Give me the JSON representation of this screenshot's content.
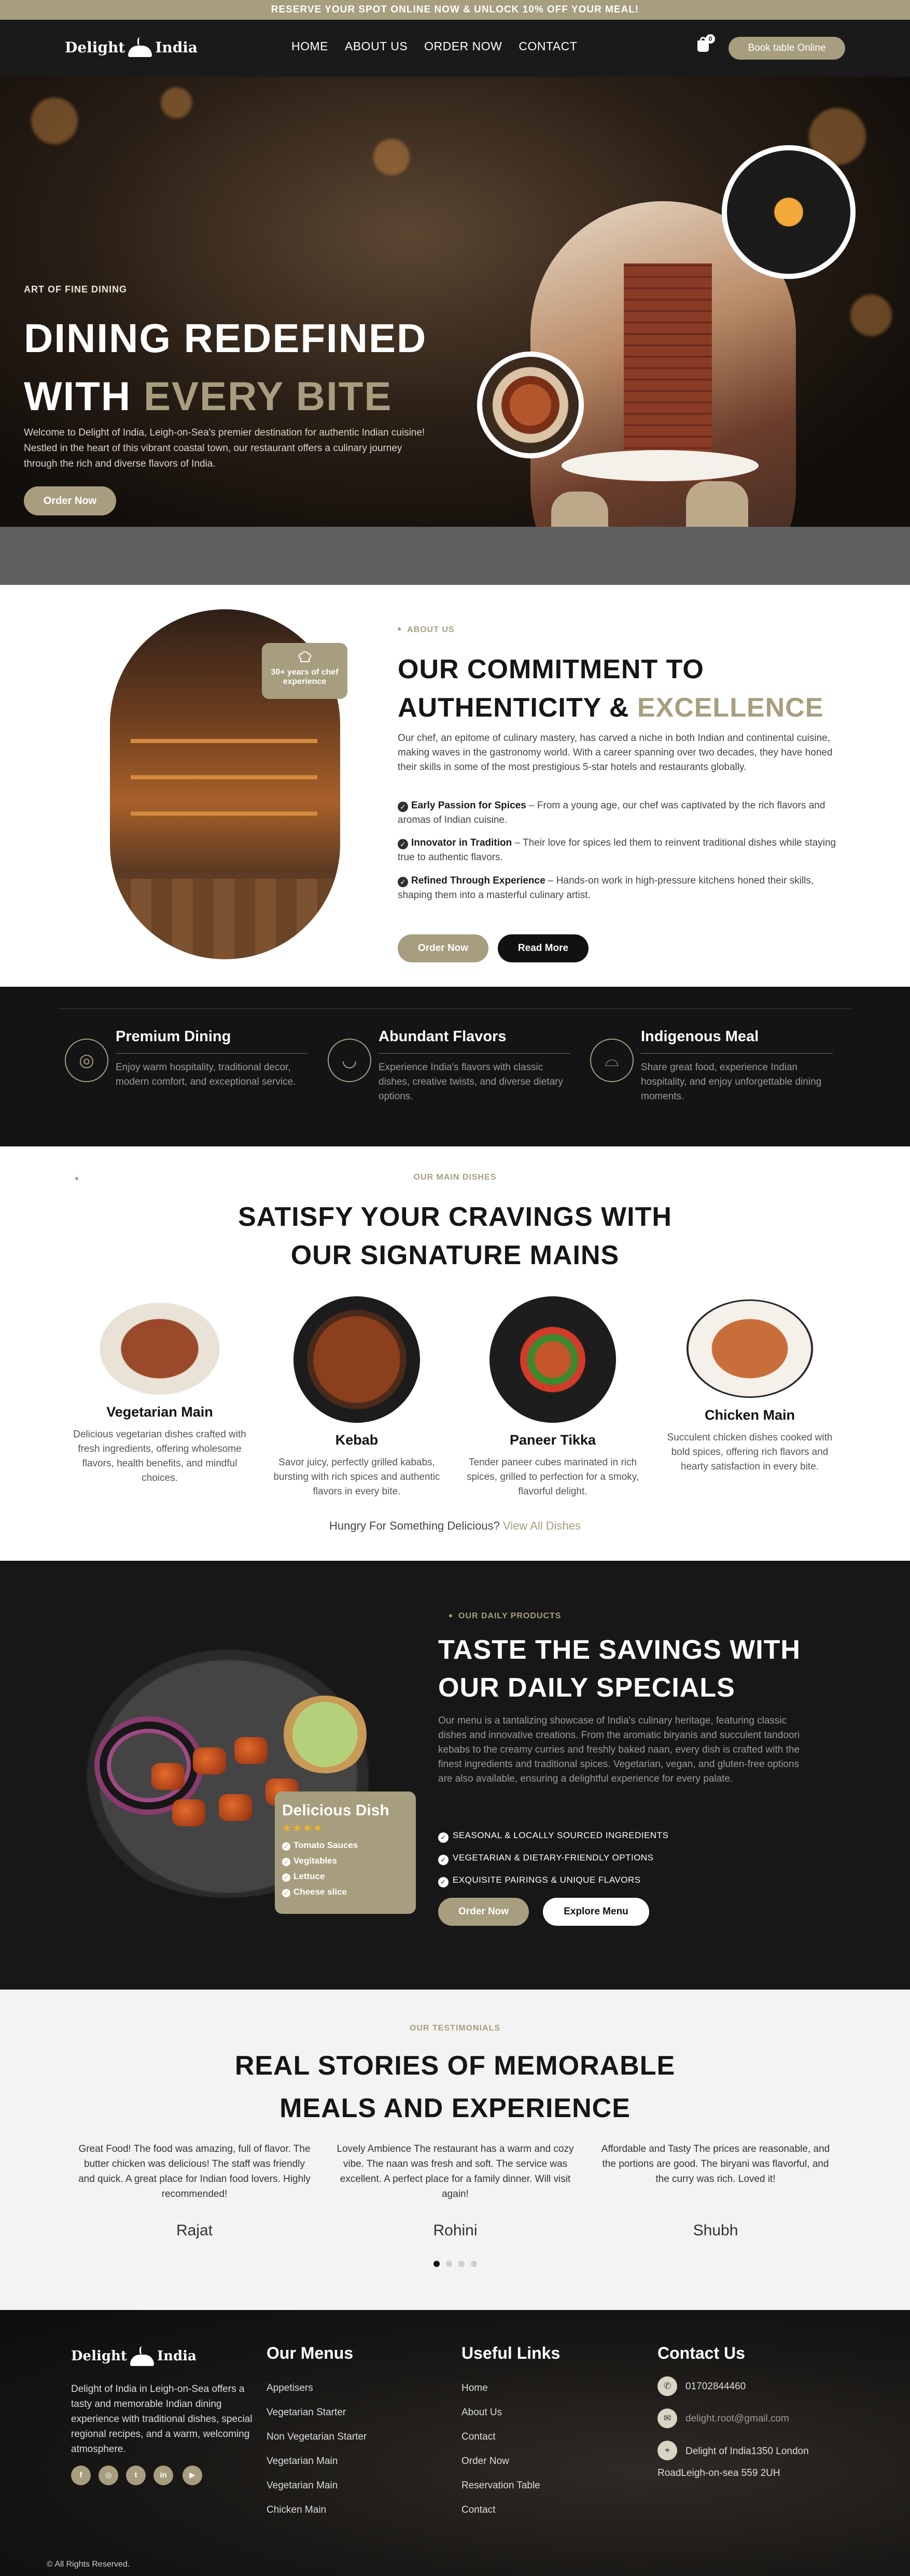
{
  "announcement": "RESERVE YOUR SPOT ONLINE NOW & UNLOCK 10% OFF YOUR MEAL!",
  "brand": {
    "left": "Delight",
    "mark": "of",
    "right": "India"
  },
  "nav": [
    {
      "label": "HOME"
    },
    {
      "label": "ABOUT US"
    },
    {
      "label": "ORDER NOW"
    },
    {
      "label": "CONTACT"
    }
  ],
  "cart": {
    "count": "0",
    "icon": "shopping-bag-icon"
  },
  "book_button": "Book table Online",
  "hero": {
    "eyebrow": "ART OF FINE DINING",
    "title_line1": "DINING REDEFINED",
    "title_line2_plain": "WITH ",
    "title_line2_accent": "EVERY BITE",
    "text": "Welcome to Delight of India, Leigh-on-Sea's premier destination for authentic Indian cuisine! Nestled in the heart of this vibrant coastal town, our restaurant offers a culinary journey through the rich and diverse flavors of India.",
    "button": "Order Now"
  },
  "about": {
    "eyebrow": "ABOUT US",
    "badge": "30+ years of chef experience",
    "title_line1": "OUR COMMITMENT TO",
    "title_line2_plain": "AUTHENTICITY & ",
    "title_line2_accent": "EXCELLENCE",
    "text": "Our chef, an epitome of culinary mastery, has carved a niche in both Indian and continental cuisine, making waves in the gastronomy world. With a career spanning over two decades, they have honed their skills in some of the most prestigious 5-star hotels and restaurants globally.",
    "points": [
      {
        "title": "Early Passion for Spices",
        "text": " – From a young age, our chef was captivated by the rich flavors and aromas of Indian cuisine."
      },
      {
        "title": "Innovator in Tradition",
        "text": " – Their love for spices led them to reinvent traditional dishes while staying true to authentic flavors."
      },
      {
        "title": "Refined Through Experience",
        "text": " – Hands-on work in high-pressure kitchens honed their skills, shaping them into a masterful culinary artist."
      }
    ],
    "btn_order": "Order Now",
    "btn_more": "Read More"
  },
  "features": [
    {
      "title": "Premium Dining",
      "text": "Enjoy warm hospitality, traditional decor, modern comfort, and exceptional service.",
      "icon": "dining-plate-icon"
    },
    {
      "title": "Abundant Flavors",
      "text": "Experience India's flavors with classic dishes, creative twists, and diverse dietary options.",
      "icon": "bowl-icon"
    },
    {
      "title": "Indigenous Meal",
      "text": "Share great food, experience Indian hospitality, and enjoy unforgettable dining moments.",
      "icon": "cloche-icon"
    }
  ],
  "mains": {
    "eyebrow": "OUR MAIN DISHES",
    "title_line1": "SATISFY YOUR CRAVINGS WITH",
    "title_line2": "OUR SIGNATURE MAINS",
    "dishes": [
      {
        "name": "Vegetarian Main",
        "text": "Delicious vegetarian dishes crafted with fresh ingredients, offering wholesome flavors, health benefits, and mindful choices."
      },
      {
        "name": "Kebab",
        "text": "Savor juicy, perfectly grilled kababs, bursting with rich spices and authentic flavors in every bite."
      },
      {
        "name": "Paneer Tikka",
        "text": "Tender paneer cubes marinated in rich spices, grilled to perfection for a smoky, flavorful delight."
      },
      {
        "name": "Chicken Main",
        "text": "Succulent chicken dishes cooked with bold spices, offering rich flavors and hearty satisfaction in every bite."
      }
    ],
    "cta_text": "Hungry For Something Delicious? ",
    "cta_link": "View All  Dishes"
  },
  "specials": {
    "eyebrow": "OUR DAILY PRODUCTS",
    "title_line1": "TASTE THE SAVINGS WITH",
    "title_line2": "OUR DAILY SPECIALS",
    "text": "Our menu is a tantalizing showcase of India's culinary heritage, featuring classic dishes and innovative creations. From the aromatic biryanis and succulent tandoori kebabs to the creamy curries and freshly baked naan, every dish is crafted with the finest ingredients and traditional spices. Vegetarian, vegan, and gluten-free options are also available, ensuring a delightful experience for every palate.",
    "checks": [
      "SEASONAL & LOCALLY SOURCED INGREDIENTS",
      "VEGETARIAN & DIETARY-FRIENDLY OPTIONS",
      "EXQUISITE PAIRINGS & UNIQUE FLAVORS"
    ],
    "btn_order": "Order Now",
    "btn_menu": "Explore Menu",
    "card": {
      "title": "Delicious Dish",
      "rating": 4,
      "items": [
        "Tomato Sauces",
        "Vegitables",
        "Lettuce",
        "Cheese slice"
      ]
    }
  },
  "testimonials": {
    "eyebrow": "OUR TESTIMONIALS",
    "title_line1": "REAL STORIES OF MEMORABLE",
    "title_line2": "MEALS AND EXPERIENCE",
    "items": [
      {
        "text": "Great Food! The food was amazing, full of flavor. The butter chicken was delicious! The staff was friendly and quick. A great place for Indian food lovers. Highly recommended!",
        "name": "Rajat"
      },
      {
        "text": "Lovely Ambience The restaurant has a warm and cozy vibe. The naan was fresh and soft. The service was excellent. A perfect place for a family dinner. Will visit again!",
        "name": "Rohini"
      },
      {
        "text": "Affordable and Tasty The prices are reasonable, and the portions are good. The biryani was flavorful, and the curry was rich. Loved it!",
        "name": "Shubh"
      }
    ],
    "active_slide": 1,
    "slide_count": 4
  },
  "footer": {
    "about": "Delight of India in Leigh-on-Sea offers a tasty and memorable Indian dining experience with traditional dishes, special regional recipes, and a warm, welcoming atmosphere.",
    "social": [
      "f",
      "ig",
      "tw",
      "in",
      "yt"
    ],
    "menus_title": "Our Menus",
    "menus": [
      "Appetisers",
      "Vegetarian Starter",
      "Non Vegetarian Starter",
      "Vegetarian Main",
      "Vegetarian Main",
      "Chicken Main"
    ],
    "links_title": "Useful Links",
    "links": [
      "Home",
      "About Us",
      "Contact",
      "Order Now",
      "Reservation Table",
      "Contact"
    ],
    "contact_title": "Contact Us",
    "phone": "01702844460",
    "email": "delight.root@gmail.com",
    "address_line1": "Delight of India1350 London",
    "address_line2": "RoadLeigh-on-sea 559 2UH",
    "copyright": "© All Rights Reserved."
  },
  "colors": {
    "accent": "#a69e7e",
    "dark": "#171717",
    "light": "#f3f3f3"
  }
}
